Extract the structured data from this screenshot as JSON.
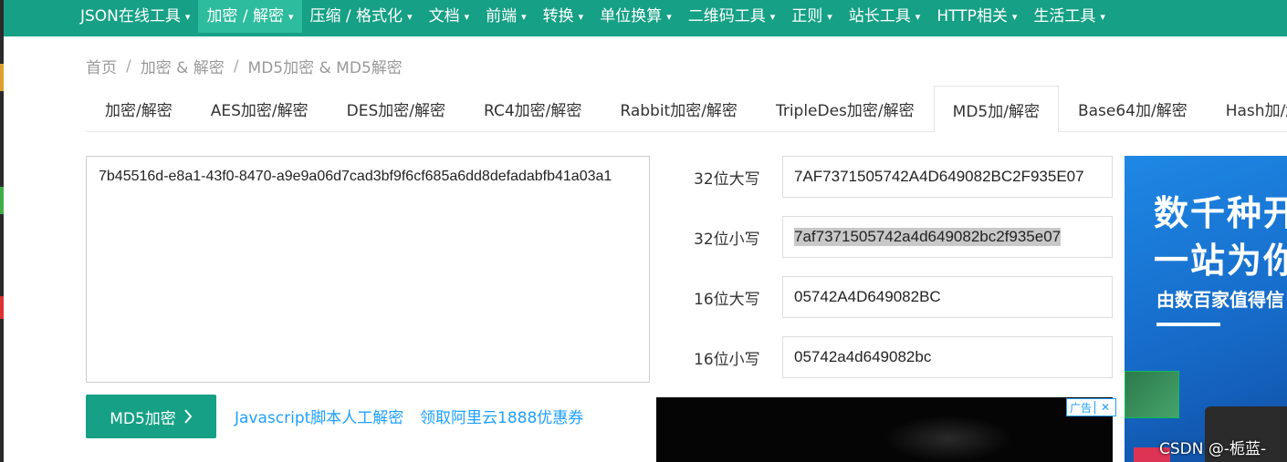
{
  "nav": {
    "items": [
      {
        "label": "JSON在线工具",
        "active": false
      },
      {
        "label": "加密 / 解密",
        "active": true
      },
      {
        "label": "压缩 / 格式化",
        "active": false
      },
      {
        "label": "文档",
        "active": false
      },
      {
        "label": "前端",
        "active": false
      },
      {
        "label": "转换",
        "active": false
      },
      {
        "label": "单位换算",
        "active": false
      },
      {
        "label": "二维码工具",
        "active": false
      },
      {
        "label": "正则",
        "active": false
      },
      {
        "label": "站长工具",
        "active": false
      },
      {
        "label": "HTTP相关",
        "active": false
      },
      {
        "label": "生活工具",
        "active": false
      }
    ],
    "caret": "▾",
    "color": "#16a085",
    "active_color": "#2ebc9e"
  },
  "breadcrumb": {
    "home": "首页",
    "category": "加密 & 解密",
    "current": "MD5加密 & MD5解密",
    "separator": "/"
  },
  "tabs": [
    {
      "label": "加密/解密",
      "active": false
    },
    {
      "label": "AES加密/解密",
      "active": false
    },
    {
      "label": "DES加密/解密",
      "active": false
    },
    {
      "label": "RC4加密/解密",
      "active": false
    },
    {
      "label": "Rabbit加密/解密",
      "active": false
    },
    {
      "label": "TripleDes加密/解密",
      "active": false
    },
    {
      "label": "MD5加/解密",
      "active": true
    },
    {
      "label": "Base64加/解密",
      "active": false
    },
    {
      "label": "Hash加/解密",
      "active": false
    }
  ],
  "input": {
    "value": "7b45516d-e8a1-43f0-8470-a9e9a06d7cad3bf9f6cf685a6dd8defadabfb41a03a1"
  },
  "results": {
    "upper32": {
      "label": "32位大写",
      "value": "7AF7371505742A4D649082BC2F935E07"
    },
    "lower32": {
      "label": "32位小写",
      "value": "7af7371505742a4d649082bc2f935e07"
    },
    "upper16": {
      "label": "16位大写",
      "value": "05742A4D649082BC"
    },
    "lower16": {
      "label": "16位小写",
      "value": "05742a4d649082bc"
    }
  },
  "actions": {
    "encrypt_button": "MD5加密",
    "encrypt_icon": "chevron-right-icon",
    "link_js": "Javascript脚本人工解密",
    "link_aliyun": "领取阿里云1888优惠券"
  },
  "ad": {
    "tag": "广告",
    "close": "✕",
    "headline_1": "数千种开",
    "headline_2": "一站为你",
    "subline": "由数百家值得信"
  },
  "watermark": "CSDN @-栀蓝-",
  "colors": {
    "accent": "#16a085",
    "link": "#1e9fff",
    "ad_blue": "#1e88e5"
  }
}
